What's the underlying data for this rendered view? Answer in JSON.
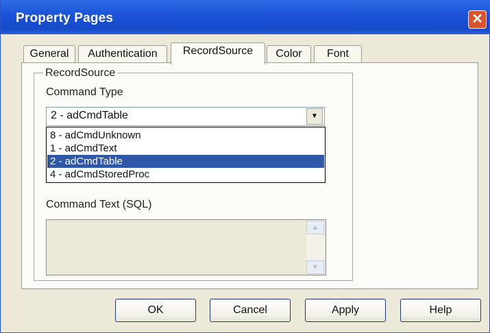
{
  "window": {
    "title": "Property Pages",
    "close_glyph": "✕"
  },
  "tabs": [
    {
      "label": "General"
    },
    {
      "label": "Authentication"
    },
    {
      "label": "RecordSource",
      "active": true
    },
    {
      "label": "Color"
    },
    {
      "label": "Font"
    }
  ],
  "record_source": {
    "group_label": "RecordSource",
    "command_type_label": "Command Type",
    "command_type_value": "2 - adCmdTable",
    "options": [
      {
        "label": "8 - adCmdUnknown"
      },
      {
        "label": "1 - adCmdText"
      },
      {
        "label": "2 - adCmdTable",
        "selected": true
      },
      {
        "label": "4 - adCmdStoredProc"
      }
    ],
    "command_text_label": "Command Text (SQL)",
    "command_text_value": ""
  },
  "buttons": {
    "ok": "OK",
    "cancel": "Cancel",
    "apply": "Apply",
    "help": "Help"
  },
  "icons": {
    "dropdown_arrow": "chevron-down-icon",
    "scroll_up": "scroll-up-icon",
    "scroll_down": "scroll-down-icon"
  },
  "colors": {
    "titlebar": "#1a52d8",
    "selection": "#2f58a8",
    "close_button": "#d9542c"
  }
}
